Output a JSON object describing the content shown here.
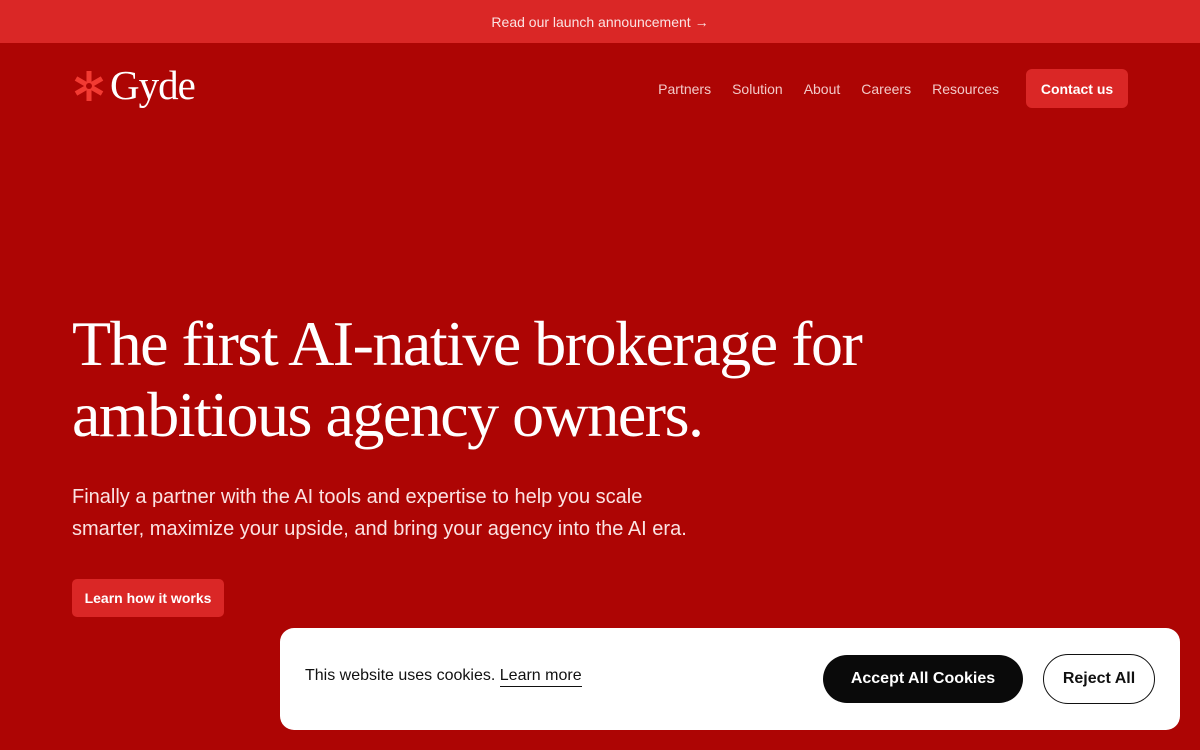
{
  "announcement": {
    "text": "Read our launch announcement",
    "arrow": "→"
  },
  "brand": {
    "name": "Gyde",
    "icon": "asterisk-burst-icon",
    "color": "#F23A32"
  },
  "nav": {
    "items": [
      {
        "label": "Partners"
      },
      {
        "label": "Solution"
      },
      {
        "label": "About"
      },
      {
        "label": "Careers"
      },
      {
        "label": "Resources"
      }
    ],
    "cta": "Contact us"
  },
  "hero": {
    "title_line1": "The first AI-native brokerage for",
    "title_line2": "ambitious agency owners.",
    "subtitle_line1": "Finally a partner with the AI tools and expertise to help you scale",
    "subtitle_line2": "smarter, maximize your upside, and bring your agency into the AI era.",
    "cta": "Learn how it works"
  },
  "cookie_banner": {
    "message": "This website uses cookies.",
    "link": "Learn more",
    "accept": "Accept All Cookies",
    "reject": "Reject All"
  },
  "colors": {
    "background": "#AD0504",
    "accent": "#DA2726"
  }
}
